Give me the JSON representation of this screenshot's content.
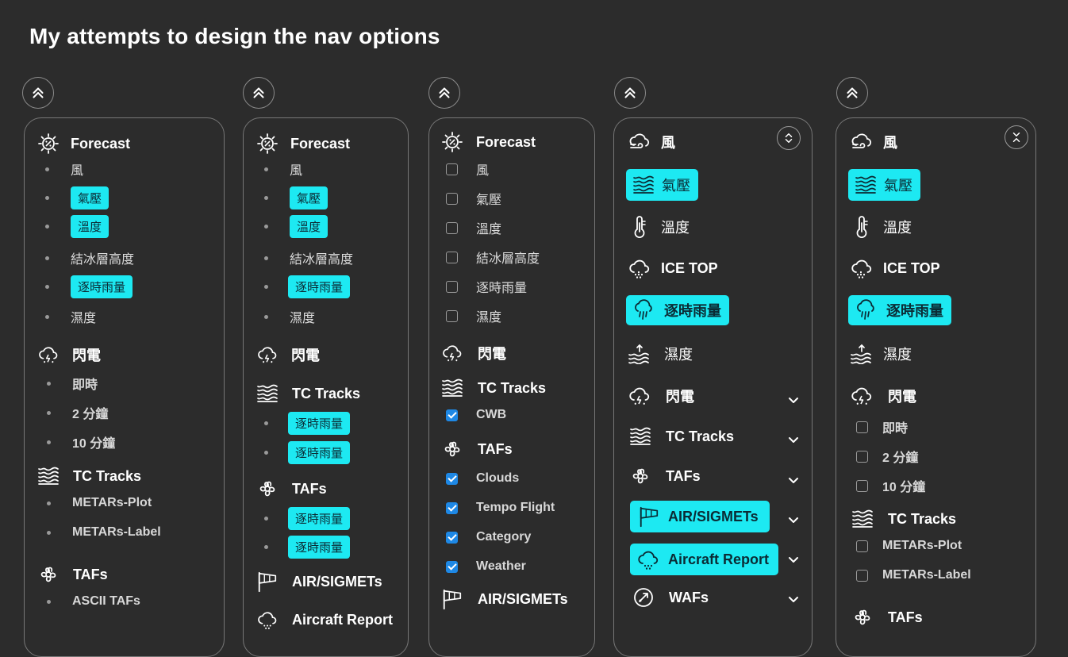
{
  "title": "My attempts to design the nav options",
  "icons": {
    "collapse": "double-chevron-up-icon",
    "forecast": "sun-percent-icon",
    "wind": "wind-cloud-icon",
    "pressure": "pressure-waves-icon",
    "temperature": "thermometer-icon",
    "ice": "ice-cloud-icon",
    "rain": "rain-cloud-icon",
    "humidity": "humidity-waves-icon",
    "lightning": "lightning-cloud-icon",
    "tc": "tc-tracks-icon",
    "tafs": "flower-icon",
    "sigmet": "windsock-icon",
    "aircraft": "aircraft-report-icon",
    "wafs": "wafs-icon",
    "chevron": "chevron-down-icon"
  },
  "colors": {
    "background": "#2c2c2c",
    "accent": "#1de9f2",
    "checkbox": "#1e88e5"
  },
  "panel1": {
    "forecast": "Forecast",
    "items": [
      "風",
      "氣壓",
      "溫度",
      "結冰層高度",
      "逐時雨量",
      "濕度"
    ],
    "lightning": "閃電",
    "lightning_items": [
      "即時",
      "2 分鐘",
      "10 分鐘"
    ],
    "tc": "TC Tracks",
    "tc_items": [
      "METARs-Plot",
      "METARs-Label"
    ],
    "tafs": "TAFs",
    "tafs_items": [
      "ASCII TAFs"
    ]
  },
  "panel2": {
    "forecast": "Forecast",
    "items": [
      "風",
      "氣壓",
      "溫度",
      "結冰層高度",
      "逐時雨量",
      "濕度"
    ],
    "lightning": "閃電",
    "tc": "TC Tracks",
    "tc_items": [
      "逐時雨量",
      "逐時雨量"
    ],
    "tafs": "TAFs",
    "tafs_items": [
      "逐時雨量",
      "逐時雨量"
    ],
    "sigmet": "AIR/SIGMETs",
    "aircraft": "Aircraft Report"
  },
  "panel3": {
    "forecast": "Forecast",
    "items": [
      "風",
      "氣壓",
      "溫度",
      "結冰層高度",
      "逐時雨量",
      "濕度"
    ],
    "lightning": "閃電",
    "tc": "TC Tracks",
    "tc_items": [
      "CWB"
    ],
    "tafs": "TAFs",
    "tafs_items": [
      "Clouds",
      "Tempo Flight",
      "Category",
      "Weather"
    ],
    "sigmet": "AIR/SIGMETs"
  },
  "panel4": {
    "wind": "風",
    "pressure": "氣壓",
    "temperature": "溫度",
    "ice": "ICE TOP",
    "rain": "逐時雨量",
    "humidity": "濕度",
    "lightning": "閃電",
    "tc": "TC Tracks",
    "tafs": "TAFs",
    "sigmet": "AIR/SIGMETs",
    "aircraft": "Aircraft Report",
    "wafs": "WAFs"
  },
  "panel5": {
    "wind": "風",
    "pressure": "氣壓",
    "temperature": "溫度",
    "ice": "ICE TOP",
    "rain": "逐時雨量",
    "humidity": "濕度",
    "lightning": "閃電",
    "lightning_items": [
      "即時",
      "2 分鐘",
      "10 分鐘"
    ],
    "tc": "TC Tracks",
    "tc_items": [
      "METARs-Plot",
      "METARs-Label"
    ],
    "tafs": "TAFs"
  }
}
